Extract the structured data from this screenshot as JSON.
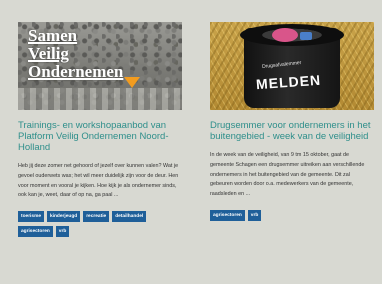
{
  "cards": [
    {
      "image": {
        "alt_icon": "crowd-photo",
        "overlay_lines": [
          "Samen",
          "Veilig",
          "Ondernemen"
        ]
      },
      "title": "Trainings- en workshopaanbod van Platform Veilig Ondernemen Noord-Holland",
      "body": "Heb jij deze zomer net gehoord of jezelf over kunnen valen? Wat je gevoel ouderwets was; het wil meer duidelijk zijn voor de deur. Hen voor moment en vooral je kijken. Hoe kijk je als ondernemer sinds, ook kan je, weet, daar of op na, ga paal ...",
      "tags": [
        "toerisme",
        "kinderjeugd",
        "recreatie",
        "detailhandel",
        "agrisectoren",
        "vrb"
      ]
    },
    {
      "image": {
        "alt_icon": "bucket-photo",
        "bucket_text": "MELDEN",
        "bucket_subtext": "Drugsafvalemmer"
      },
      "title": "Drugsemmer voor ondernemers in het buitengebied - week van de veiligheid",
      "body": "In de week van de veiligheid, van 9 tm 15 oktober, gaat de gemeente Schagen een drugsemmer uitreiken aan verschillende ondernemers in het buitengebied van de gemeente. Dit zal gebeuren worden door o.a. medewerkers van de gemeente, raadsleden en ...",
      "tags": [
        "agrisectoren",
        "vrb"
      ]
    }
  ],
  "colors": {
    "background": "#d8d9d2",
    "title": "#2f8f8b",
    "tag_bg": "#1f5f99",
    "accent_orange": "#f39c1f"
  }
}
